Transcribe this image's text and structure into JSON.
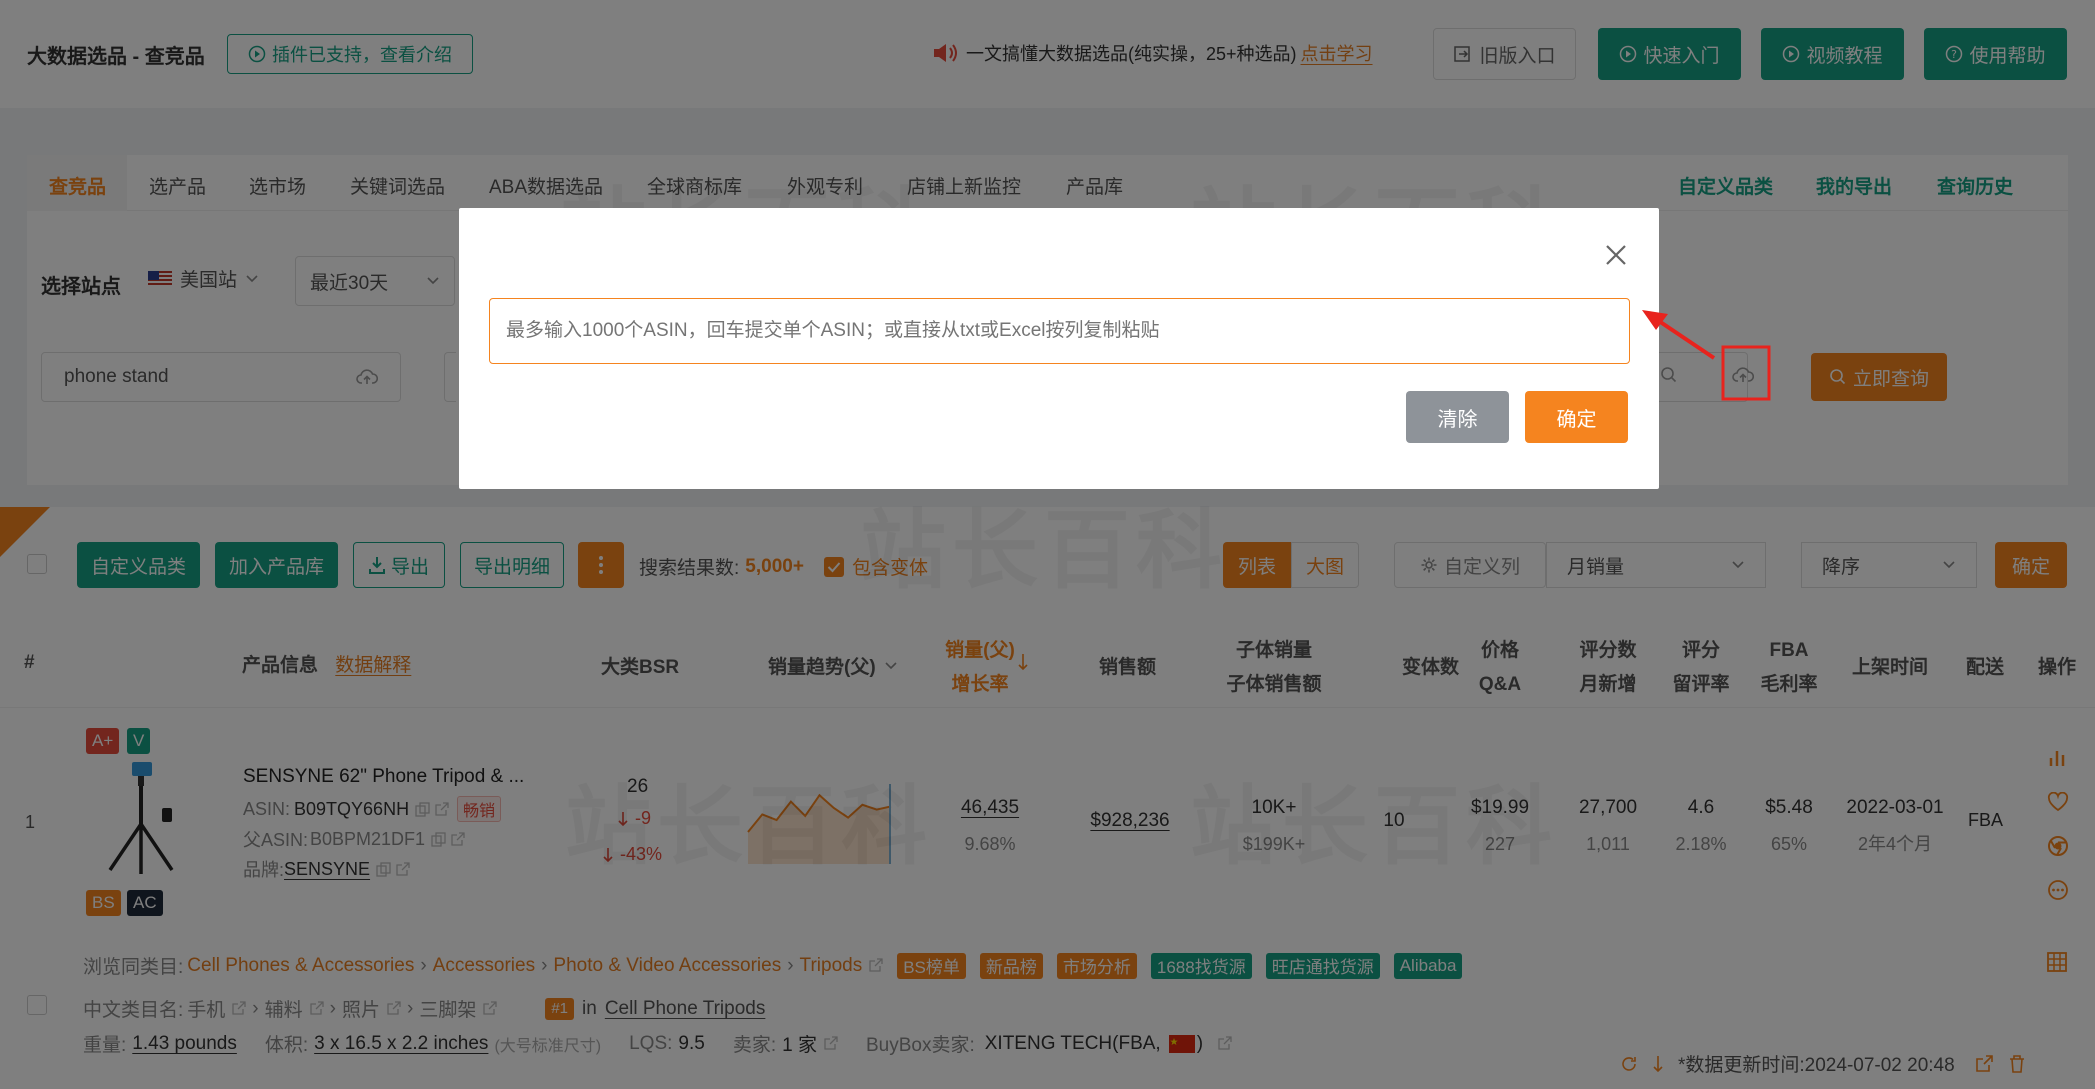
{
  "header": {
    "title": "大数据选品 - 查竞品",
    "plugin_label": "插件已支持，查看介绍",
    "announce_text": "一文搞懂大数据选品(纯实操，25+种选品)",
    "announce_link": "点击学习",
    "old_entry": "旧版入口",
    "quick_start": "快速入门",
    "video_tutorial": "视频教程",
    "help": "使用帮助"
  },
  "nav": {
    "tabs": [
      "查竞品",
      "选产品",
      "选市场",
      "关键词选品",
      "ABA数据选品",
      "全球商标库",
      "外观专利",
      "店铺上新监控",
      "产品库"
    ],
    "right": [
      "自定义品类",
      "我的导出",
      "查询历史"
    ]
  },
  "filters": {
    "site_label": "选择站点",
    "site": "美国站",
    "period": "最近30天",
    "keyword": "phone stand",
    "search_btn": "立即查询"
  },
  "toolbar": {
    "custom_category": "自定义品类",
    "add_library": "加入产品库",
    "export": "导出",
    "export_detail": "导出明细",
    "result_label": "搜索结果数:",
    "result_count": "5,000+",
    "include_variants": "包含变体",
    "view_list": "列表",
    "view_grid": "大图",
    "custom_cols": "自定义列",
    "sort_field": "月销量",
    "sort_order": "降序",
    "confirm": "确定"
  },
  "table_headers": {
    "num": "#",
    "product_info": "产品信息",
    "data_explain": "数据解释",
    "bsr": "大类BSR",
    "trend": "销量趋势(父)",
    "sales_1": "销量(父)",
    "sales_2": "增长率",
    "revenue": "销售额",
    "child_1": "子体销量",
    "child_2": "子体销售额",
    "variants": "变体数",
    "price_1": "价格",
    "price_2": "Q&A",
    "reviews_1": "评分数",
    "reviews_2": "月新增",
    "rating_1": "评分",
    "rating_2": "留评率",
    "fba_1": "FBA",
    "fba_2": "毛利率",
    "listed": "上架时间",
    "fulfill": "配送",
    "ops": "操作"
  },
  "product": {
    "index": "1",
    "badges": [
      "A+",
      "V",
      "BS",
      "AC"
    ],
    "title": "SENSYNE 62\" Phone Tripod & ...",
    "asin_label": "ASIN:",
    "asin": "B09TQY66NH",
    "hot": "畅销",
    "parent_label": "父ASIN:",
    "parent_asin": "B0BPM21DF1",
    "brand_label": "品牌:",
    "brand": "SENSYNE",
    "bsr": "26",
    "bsr_change": "-9",
    "bsr_pct": "-43%",
    "sales": "46,435",
    "growth": "9.68%",
    "revenue": "$928,236",
    "child_sales": "10K+",
    "child_revenue": "$199K+",
    "variants": "10",
    "price": "$19.99",
    "qa": "227",
    "reviews": "27,700",
    "reviews_new": "1,011",
    "rating": "4.6",
    "review_rate": "2.18%",
    "fba": "$5.48",
    "margin": "65%",
    "listed": "2022-03-01",
    "listed_age": "2年4个月",
    "fulfill": "FBA"
  },
  "trend_points": [
    0.4,
    0.62,
    0.55,
    0.78,
    0.6,
    0.86,
    0.7,
    0.58,
    0.74,
    0.68,
    0.72
  ],
  "category": {
    "label": "浏览同类目:",
    "path": [
      "Cell Phones & Accessories",
      "Accessories",
      "Photo & Video Accessories",
      "Tripods"
    ],
    "tags": [
      "BS榜单",
      "新品榜",
      "市场分析",
      "1688找货源",
      "旺店通找货源",
      "Alibaba"
    ],
    "cn_label": "中文类目名:",
    "cn_path": [
      "手机",
      "辅料",
      "照片",
      "三脚架"
    ],
    "rank": "#1",
    "rank_in": "in",
    "rank_cat": "Cell Phone Tripods"
  },
  "details": {
    "weight_label": "重量:",
    "weight": "1.43 pounds",
    "volume_label": "体积:",
    "volume": "3 x 16.5 x 2.2 inches",
    "volume_note": "(大号标准尺寸)",
    "lqs_label": "LQS:",
    "lqs": "9.5",
    "seller_label": "卖家:",
    "seller": "1 家",
    "buybox_label": "BuyBox卖家:",
    "buybox": "XITENG TECH(FBA,",
    "updated": "*数据更新时间:2024-07-02 20:48"
  },
  "modal": {
    "placeholder": "最多输入1000个ASIN，回车提交单个ASIN；或直接从txt或Excel按列复制粘贴",
    "clear": "清除",
    "ok": "确定"
  },
  "watermark": "站长百科",
  "colors": {
    "green": "#16a085",
    "orange": "#f5841f",
    "red": "#e74c3c"
  }
}
